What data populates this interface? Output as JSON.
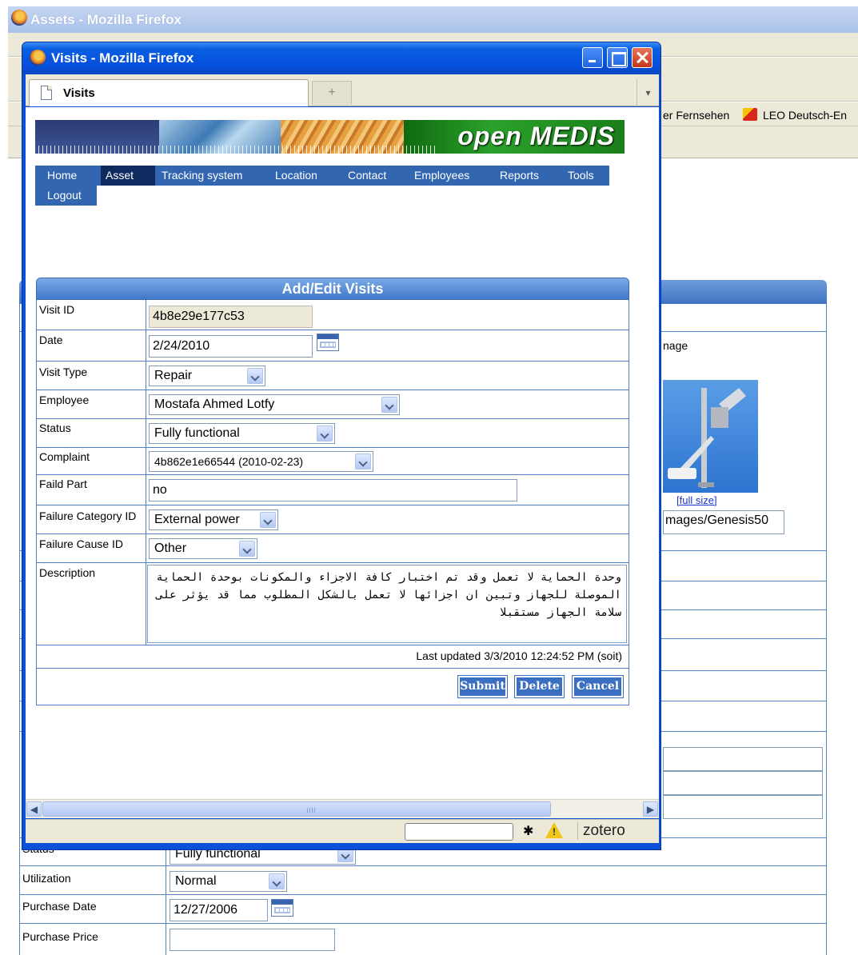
{
  "background_window": {
    "title": "Assets - Mozilla Firefox",
    "bookmarks": {
      "item1": "er Fernsehen",
      "item2": "LEO Deutsch-En"
    },
    "image_label": "nage",
    "full_size_link": "[full size]",
    "image_path": "mages/Genesis50",
    "rows": {
      "status": {
        "label": "Status",
        "value": "Fully functional"
      },
      "utilization": {
        "label": "Utilization",
        "value": "Normal"
      },
      "purchase_date": {
        "label": "Purchase Date",
        "value": "12/27/2006"
      },
      "purchase_price": {
        "label": "Purchase Price",
        "value": ""
      }
    }
  },
  "popup": {
    "title": "Visits - Mozilla Firefox",
    "tab_label": "Visits",
    "banner_title": "open MEDIS",
    "nav": [
      "Home",
      "Asset",
      "Tracking system",
      "Location",
      "Contact",
      "Employees",
      "Reports",
      "Tools"
    ],
    "nav_logout": "Logout",
    "form": {
      "title": "Add/Edit Visits",
      "fields": {
        "visit_id": {
          "label": "Visit ID",
          "value": "4b8e29e177c53"
        },
        "date": {
          "label": "Date",
          "value": "2/24/2010"
        },
        "visit_type": {
          "label": "Visit Type",
          "value": "Repair"
        },
        "employee": {
          "label": "Employee",
          "value": "Mostafa Ahmed Lotfy"
        },
        "status": {
          "label": "Status",
          "value": "Fully functional"
        },
        "complaint": {
          "label": "Complaint",
          "value": "4b862e1e66544 (2010-02-23)"
        },
        "faild_part": {
          "label": "Faild Part",
          "value": "no"
        },
        "failure_category": {
          "label": "Failure Category ID",
          "value": "External power"
        },
        "failure_cause": {
          "label": "Failure Cause ID",
          "value": "Other"
        },
        "description": {
          "label": "Description",
          "value": "وحدة الحماية لا تعمل وقد تم اختبار كافة الاجزاء والمكونات بوحدة الحماية الموصلة للجهاز وتبين ان اجزائها لا تعمل بالشكل المطلوب مما قد يؤثر على سلامة الجهاز مستقبلا"
        }
      },
      "last_updated": "Last updated 3/3/2010 12:24:52 PM  (soit)",
      "buttons": {
        "submit": "Submit",
        "delete": "Delete",
        "cancel": "Cancel"
      }
    },
    "statusbar": {
      "zotero": "zotero"
    }
  }
}
